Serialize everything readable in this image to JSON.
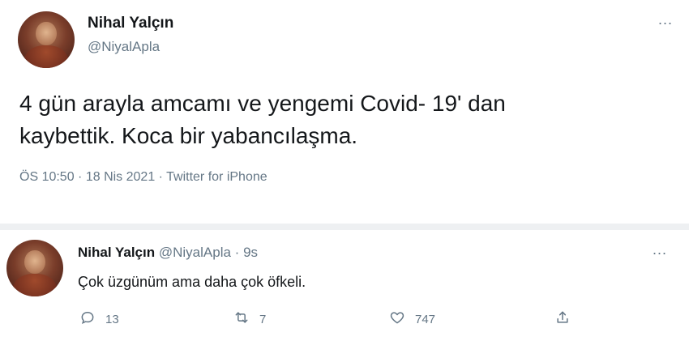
{
  "main_tweet": {
    "name": "Nihal Yalçın",
    "handle": "@NiyalApla",
    "more": "...",
    "text_line1": "4 gün arayla amcamı ve yengemi Covid- 19' dan",
    "text_line2": "kaybettik. Koca bir yabancılaşma.",
    "meta": "ÖS 10:50 · 18 Nis 2021 · Twitter for iPhone"
  },
  "reply_tweet": {
    "name": "Nihal Yalçın",
    "handle": "@NiyalApla",
    "separator": "·",
    "time": "9s",
    "more": "...",
    "text": "Çok üzgünüm ama daha çok öfkeli.",
    "actions": {
      "reply_count": "13",
      "retweet_count": "7",
      "like_count": "747"
    }
  },
  "icons": {
    "reply": "reply-icon",
    "retweet": "retweet-icon",
    "like": "heart-icon",
    "share": "share-icon",
    "more": "more-icon"
  },
  "colors": {
    "text": "#14171a",
    "secondary": "#657786",
    "divider": "#eef0f2"
  }
}
